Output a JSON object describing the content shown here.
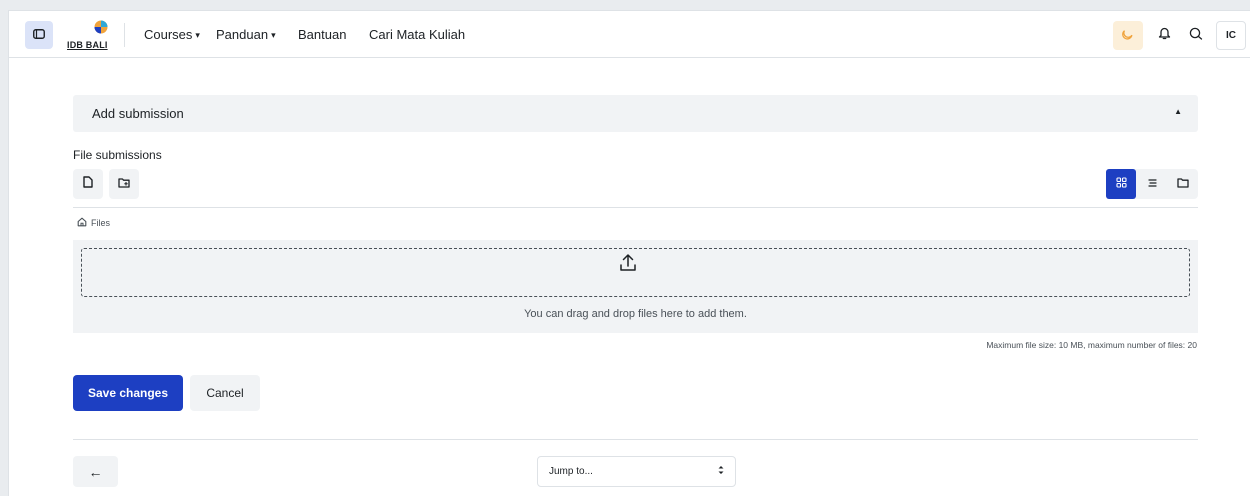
{
  "navbar": {
    "logo_text": "IDB BALI",
    "items": [
      {
        "label": "Courses",
        "has_dropdown": true
      },
      {
        "label": "Panduan",
        "has_dropdown": true
      },
      {
        "label": "Bantuan",
        "has_dropdown": false
      },
      {
        "label": "Cari Mata Kuliah",
        "has_dropdown": false
      }
    ],
    "dropdown_caret": "▾",
    "user_initials": "IC"
  },
  "icons": {
    "drawer": "sidebar-toggle-icon",
    "theme": "moon-icon",
    "notifications": "bell-icon",
    "messages": "chat-icon",
    "add_file": "file-icon",
    "create_folder": "folder-plus-icon",
    "view_icons": "grid-icon",
    "view_list": "list-icon",
    "view_tree": "folder-icon",
    "home": "home-icon",
    "upload": "upload-icon",
    "back": "arrow-left-icon"
  },
  "submission": {
    "section_title": "Add submission",
    "collapse_indicator": "▲",
    "field_label": "File submissions",
    "breadcrumb": "Files",
    "dropzone_text": "You can drag and drop files here to add them.",
    "limits_text": "Maximum file size: 10 MB, maximum number of files: 20"
  },
  "actions": {
    "save_label": "Save changes",
    "cancel_label": "Cancel"
  },
  "footer_nav": {
    "back_glyph": "←",
    "jump_placeholder": "Jump to...",
    "jump_arrow_up": "▲",
    "jump_arrow_down": "▼"
  },
  "colors": {
    "primary": "#1d3fc2",
    "theme_accent": "#f0a33c",
    "light_bg": "#f1f3f5"
  }
}
